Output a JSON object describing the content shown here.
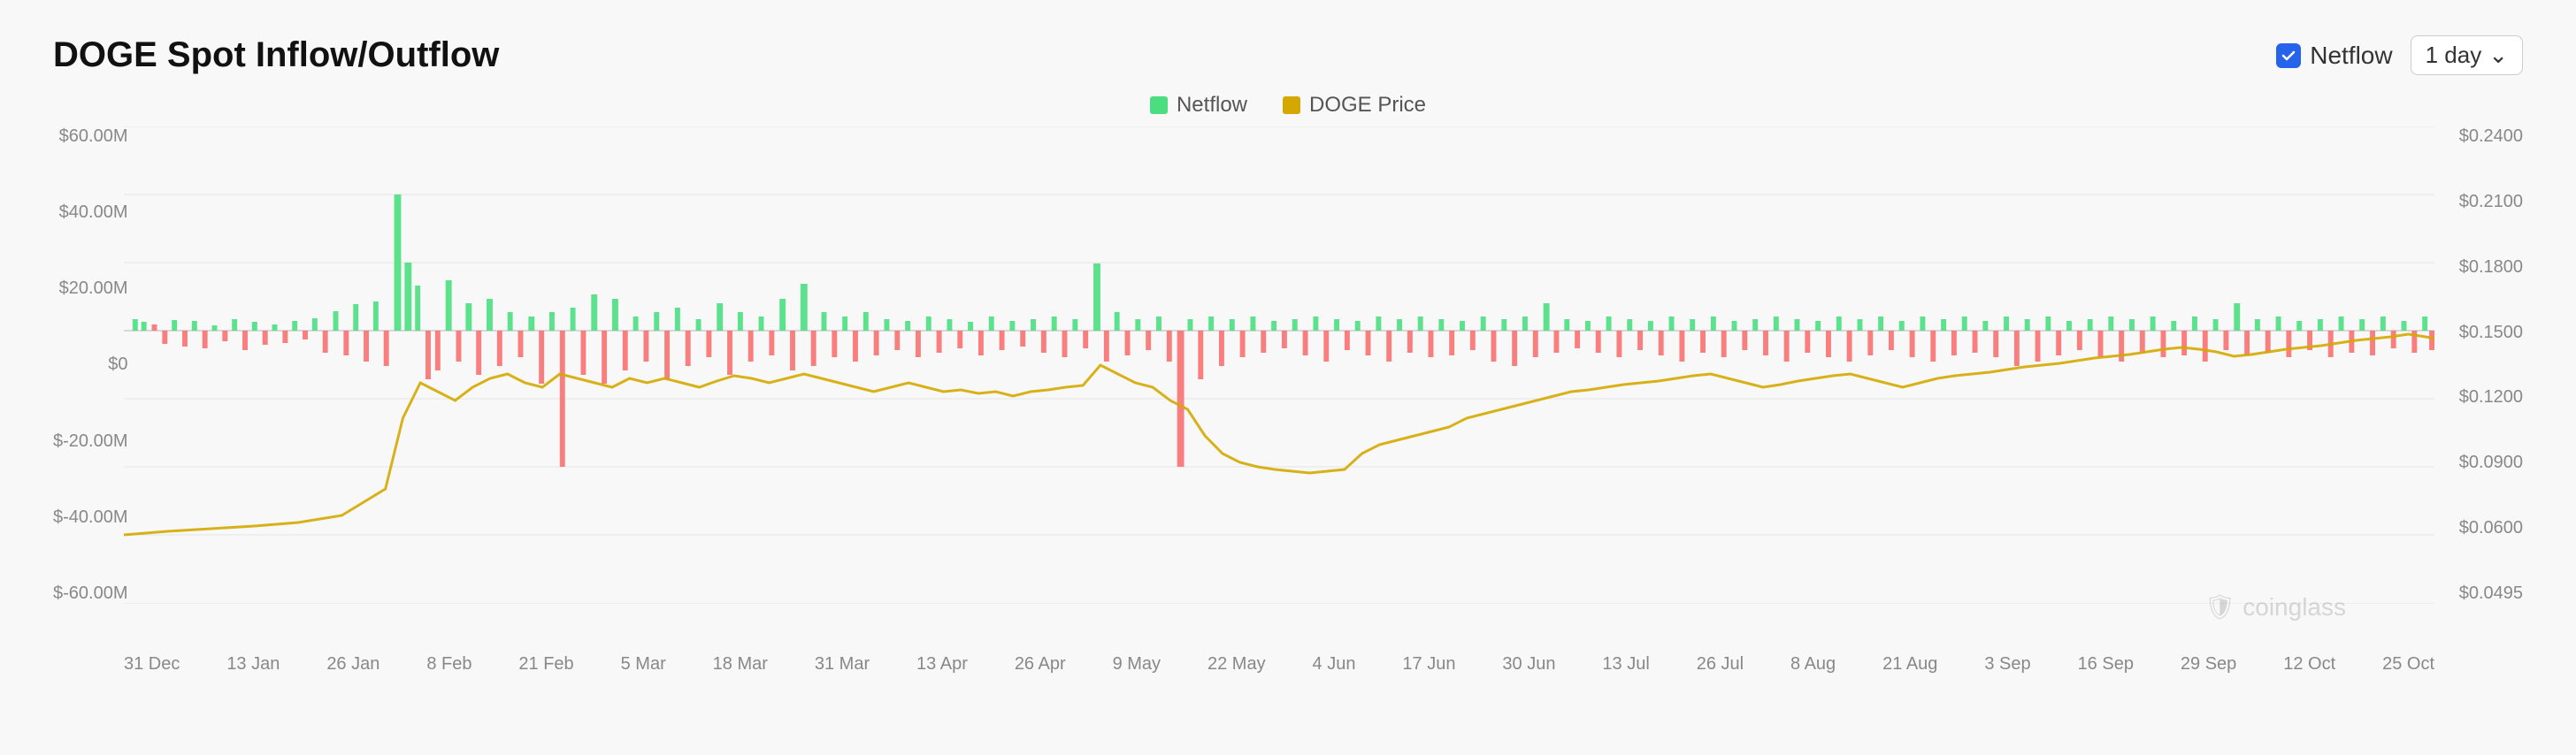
{
  "title": "DOGE Spot Inflow/Outflow",
  "header": {
    "netflow_label": "Netflow",
    "day_selector": "1 day"
  },
  "legend": {
    "items": [
      {
        "label": "Netflow",
        "color": "#4ade80"
      },
      {
        "label": "DOGE Price",
        "color": "#d4a800"
      }
    ]
  },
  "y_axis_left": {
    "labels": [
      "$60.00M",
      "$40.00M",
      "$20.00M",
      "$0",
      "$-20.00M",
      "$-40.00M",
      "$-60.00M"
    ]
  },
  "y_axis_right": {
    "labels": [
      "$0.2400",
      "$0.2100",
      "$0.1800",
      "$0.1500",
      "$0.1200",
      "$0.0900",
      "$0.0600",
      "$0.0495"
    ]
  },
  "x_axis": {
    "labels": [
      "31 Dec",
      "13 Jan",
      "26 Jan",
      "8 Feb",
      "21 Feb",
      "5 Mar",
      "18 Mar",
      "31 Mar",
      "13 Apr",
      "26 Apr",
      "9 May",
      "22 May",
      "4 Jun",
      "17 Jun",
      "30 Jun",
      "13 Jul",
      "26 Jul",
      "8 Aug",
      "21 Aug",
      "3 Sep",
      "16 Sep",
      "29 Sep",
      "12 Oct",
      "25 Oct"
    ]
  },
  "watermark": "coinglass",
  "colors": {
    "positive": "#4ade80",
    "negative": "#f87171",
    "price_line": "#d4a800",
    "grid": "#e5e5e5",
    "background": "#f8f8f8"
  }
}
